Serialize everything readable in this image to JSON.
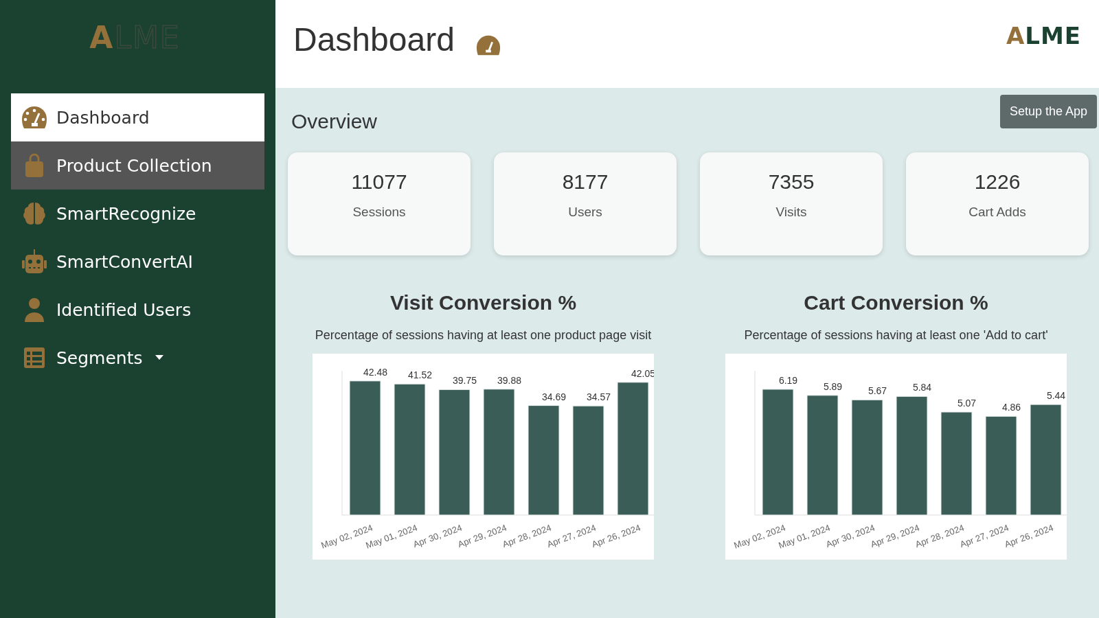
{
  "sidebar": {
    "logo": {
      "accent": "A",
      "rest": "LME"
    },
    "items": [
      {
        "label": "Dashboard",
        "selected": true,
        "hovered": false,
        "kind": "link"
      },
      {
        "label": "Product Collection",
        "selected": false,
        "hovered": true,
        "kind": "link"
      },
      {
        "label": "SmartRecognize",
        "selected": false,
        "hovered": false,
        "kind": "link"
      },
      {
        "label": "SmartConvertAI",
        "selected": false,
        "hovered": false,
        "kind": "link"
      },
      {
        "label": "Identified Users",
        "selected": false,
        "hovered": false,
        "kind": "link"
      },
      {
        "label": "Segments",
        "selected": false,
        "hovered": false,
        "kind": "dropdown"
      }
    ]
  },
  "header": {
    "title": "Dashboard",
    "logo": {
      "accent": "A",
      "rest": "LME"
    }
  },
  "overview": {
    "title": "Overview",
    "setup_button": "Setup the App",
    "stats": [
      {
        "value": "11077",
        "label": "Sessions"
      },
      {
        "value": "8177",
        "label": "Users"
      },
      {
        "value": "7355",
        "label": "Visits"
      },
      {
        "value": "1226",
        "label": "Cart Adds"
      }
    ]
  },
  "charts": [
    {
      "title": "Visit Conversion %",
      "subtitle": "Percentage of sessions having at least one product page visit",
      "chart_data": {
        "type": "bar",
        "categories": [
          "May 02, 2024",
          "May 01, 2024",
          "Apr 30, 2024",
          "Apr 29, 2024",
          "Apr 28, 2024",
          "Apr 27, 2024",
          "Apr 26, 2024"
        ],
        "series": [
          {
            "color": "#3b5d58",
            "values": [
              42.48,
              41.52,
              39.75,
              39.88,
              34.69,
              34.57,
              42.05
            ]
          }
        ],
        "ylim": [
          0,
          45.7
        ],
        "data_labels": true
      }
    },
    {
      "title": "Cart Conversion %",
      "subtitle": "Percentage of sessions having at least one 'Add to cart'",
      "chart_data": {
        "type": "bar",
        "categories": [
          "May 02, 2024",
          "May 01, 2024",
          "Apr 30, 2024",
          "Apr 29, 2024",
          "Apr 28, 2024",
          "Apr 27, 2024",
          "Apr 26, 2024"
        ],
        "series": [
          {
            "color": "#3b5d58",
            "values": [
              6.19,
              5.89,
              5.67,
              5.84,
              5.07,
              4.86,
              5.44
            ]
          }
        ],
        "ylim": [
          0,
          7.1
        ],
        "data_labels": true
      }
    }
  ]
}
